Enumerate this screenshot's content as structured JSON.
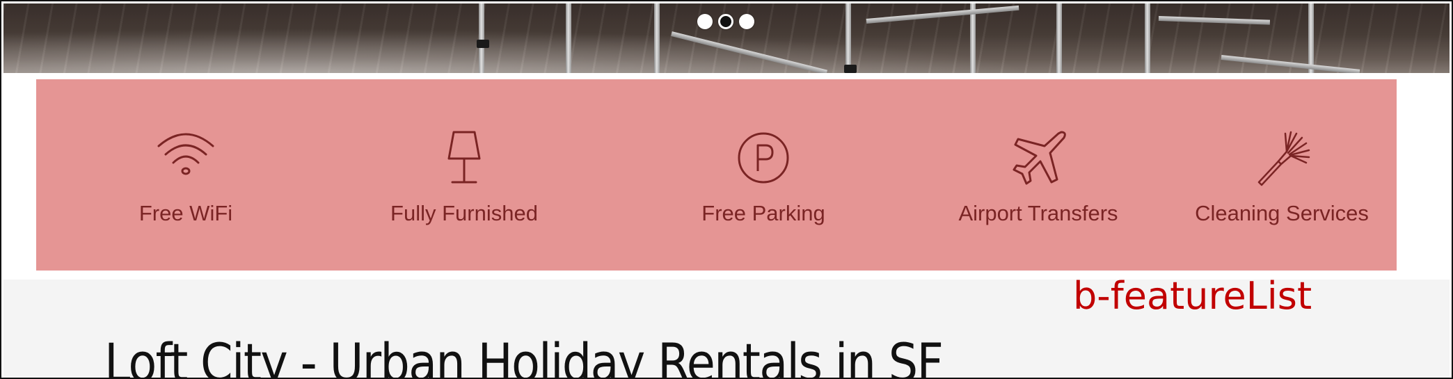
{
  "hero": {
    "slider_dots": [
      {
        "state": "inactive"
      },
      {
        "state": "active"
      },
      {
        "state": "inactive"
      }
    ]
  },
  "feature_list": {
    "background_color": "#e59594",
    "text_color": "#7a2424",
    "items": [
      {
        "icon": "wifi-icon",
        "label": "Free WiFi"
      },
      {
        "icon": "lamp-icon",
        "label": "Fully Furnished"
      },
      {
        "icon": "parking-icon",
        "label": "Free Parking"
      },
      {
        "icon": "airplane-icon",
        "label": "Airport Transfers"
      },
      {
        "icon": "duster-icon",
        "label": "Cleaning Services"
      }
    ]
  },
  "annotation": {
    "text": "b-featureList",
    "color": "#c10000"
  },
  "page": {
    "heading": "Loft City - Urban Holiday Rentals in SF"
  }
}
